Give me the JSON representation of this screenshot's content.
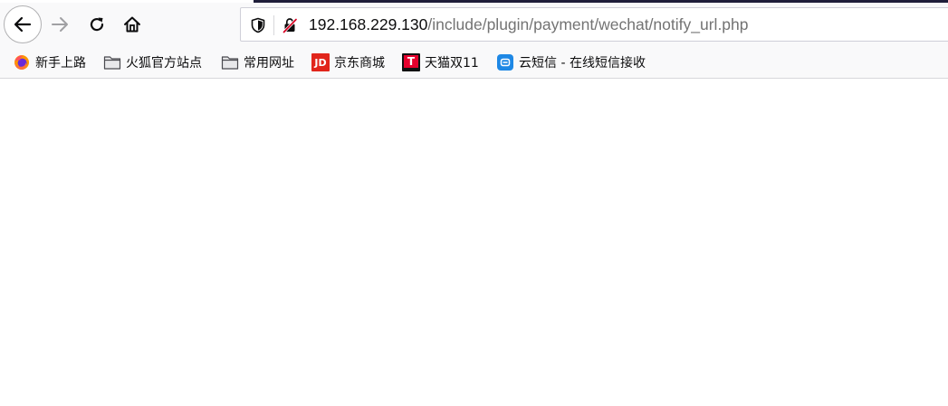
{
  "toolbar": {
    "back_icon": "arrow-left-icon",
    "forward_icon": "arrow-right-icon",
    "reload_icon": "reload-icon",
    "home_icon": "home-icon"
  },
  "url_bar": {
    "tracking_icon": "shield-icon",
    "insecure_icon": "insecure-lock-icon",
    "host": "192.168.229.130",
    "path": "/include/plugin/payment/wechat/notify_url.php"
  },
  "bookmarks": [
    {
      "label": "新手上路",
      "icon": "firefox-icon"
    },
    {
      "label": "火狐官方站点",
      "icon": "folder-icon"
    },
    {
      "label": "常用网址",
      "icon": "folder-icon"
    },
    {
      "label": "京东商城",
      "icon": "jd-icon",
      "icon_text": "JD"
    },
    {
      "label": "天猫双11",
      "icon": "tmall-icon",
      "icon_text": "T"
    },
    {
      "label": "云短信 - 在线短信接收",
      "icon": "cloud-sms-icon"
    }
  ],
  "page": {
    "content": ""
  },
  "colors": {
    "toolbar_bg": "#f9f9fa",
    "url_host": "#0c0c0d",
    "url_path": "#737373",
    "jd_red": "#e1251b",
    "tmall_red": "#e6002d",
    "cloud_blue": "#1e88e5"
  }
}
